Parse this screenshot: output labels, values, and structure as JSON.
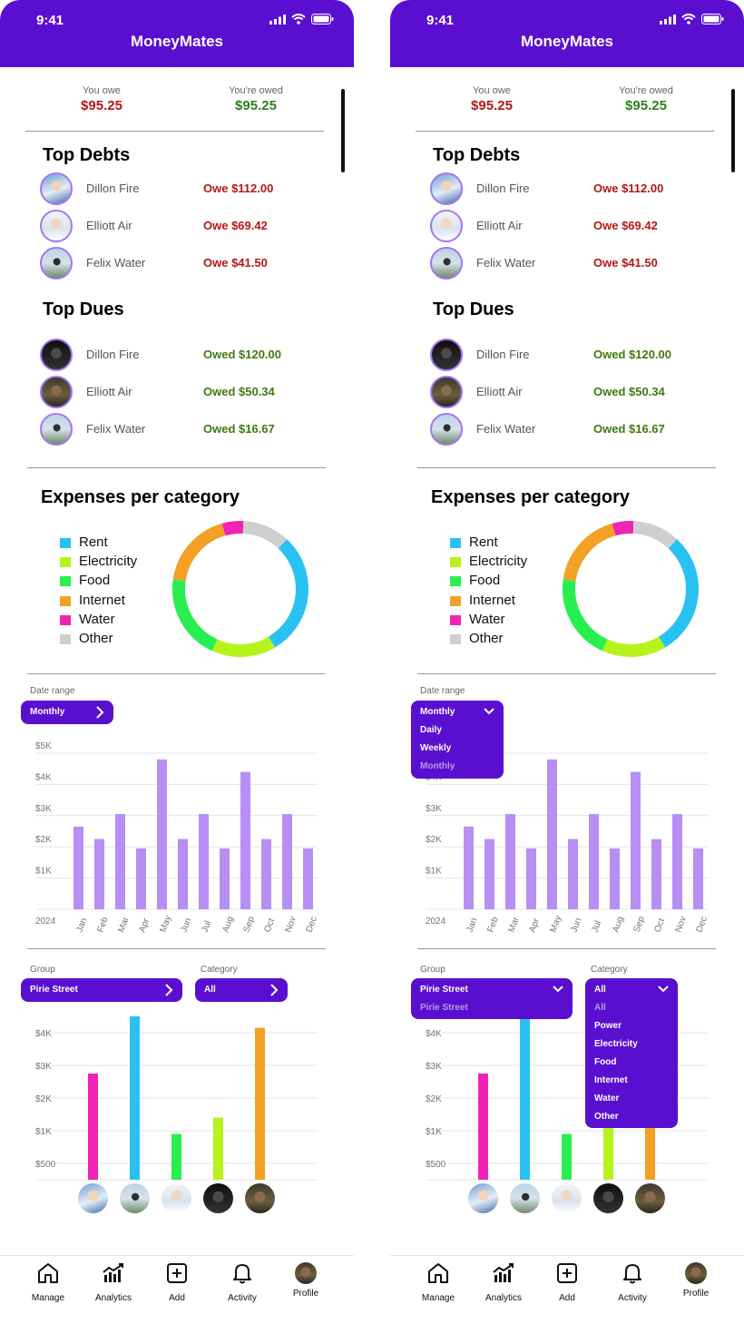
{
  "status_bar": {
    "time": "9:41"
  },
  "app": {
    "title": "MoneyMates"
  },
  "summary": {
    "you_owe_label": "You owe",
    "you_owe_value": "$95.25",
    "owed_label": "You're owed",
    "owed_value": "$95.25"
  },
  "top_debts": {
    "title": "Top Debts",
    "items": [
      {
        "name": "Dillon Fire",
        "amount": "Owe $112.00"
      },
      {
        "name": "Elliott Air",
        "amount": "Owe $69.42"
      },
      {
        "name": "Felix Water",
        "amount": "Owe $41.50"
      }
    ]
  },
  "top_dues": {
    "title": "Top Dues",
    "items": [
      {
        "name": "Dillon Fire",
        "amount": "Owed $120.00"
      },
      {
        "name": "Elliott Air",
        "amount": "Owed $50.34"
      },
      {
        "name": "Felix Water",
        "amount": "Owed $16.67"
      }
    ]
  },
  "expenses": {
    "title": "Expenses per category",
    "legend": [
      "Rent",
      "Electricity",
      "Food",
      "Internet",
      "Water",
      "Other"
    ],
    "colors": [
      "#29c1f2",
      "#b7f21c",
      "#29ee4f",
      "#f4a024",
      "#f024b4",
      "#cfcfcf"
    ]
  },
  "date_range": {
    "label": "Date range",
    "selected": "Monthly",
    "options": [
      "Daily",
      "Weekly",
      "Monthly"
    ]
  },
  "group_filter": {
    "label": "Group",
    "selected": "Pirie Street",
    "options": [
      "Pirie Street"
    ]
  },
  "category_filter": {
    "label": "Category",
    "selected": "All",
    "options": [
      "All",
      "Power",
      "Electricity",
      "Food",
      "Internet",
      "Water",
      "Other"
    ]
  },
  "chart_data": [
    {
      "type": "donut",
      "categories": [
        "Rent",
        "Electricity",
        "Food",
        "Internet",
        "Water",
        "Other"
      ],
      "values": [
        29,
        15,
        20,
        18,
        5,
        11
      ],
      "colors": [
        "#29c1f2",
        "#b7f21c",
        "#29ee4f",
        "#f4a024",
        "#f024b4",
        "#cfcfcf"
      ],
      "title": "Expenses per category",
      "legend": "left"
    },
    {
      "type": "bar",
      "categories": [
        "Jan",
        "Feb",
        "Mar",
        "Apr",
        "May",
        "Jun",
        "Jul",
        "Aug",
        "Sep",
        "Oct",
        "Nov",
        "Dec"
      ],
      "values": [
        2650,
        2250,
        3050,
        1950,
        4800,
        2250,
        3050,
        1950,
        4400,
        2250,
        3050,
        1950
      ],
      "y_ticks": [
        "$1K",
        "$2K",
        "$3K",
        "$4K",
        "$5K"
      ],
      "x_caption": "2024",
      "ylim": [
        0,
        5000
      ],
      "color": "#b68ef4",
      "grid": true
    },
    {
      "type": "bar",
      "categories": [
        "Dillon Fire",
        "Felix Water",
        "Elliott Air",
        "Dillon Fire",
        "Elliott Air"
      ],
      "values": [
        2750,
        4700,
        950,
        1400,
        4150
      ],
      "colors": [
        "#f024b4",
        "#29c1f2",
        "#29ee4f",
        "#b7f21c",
        "#f4a024"
      ],
      "y_ticks": [
        "$500",
        "$1K",
        "$2K",
        "$3K",
        "$4K"
      ],
      "grid": true
    }
  ],
  "tabs": [
    {
      "label": "Manage",
      "icon": "home-icon"
    },
    {
      "label": "Analytics",
      "icon": "analytics-icon"
    },
    {
      "label": "Add",
      "icon": "add-icon"
    },
    {
      "label": "Activity",
      "icon": "bell-icon"
    },
    {
      "label": "Profile",
      "icon": "profile-avatar"
    }
  ]
}
